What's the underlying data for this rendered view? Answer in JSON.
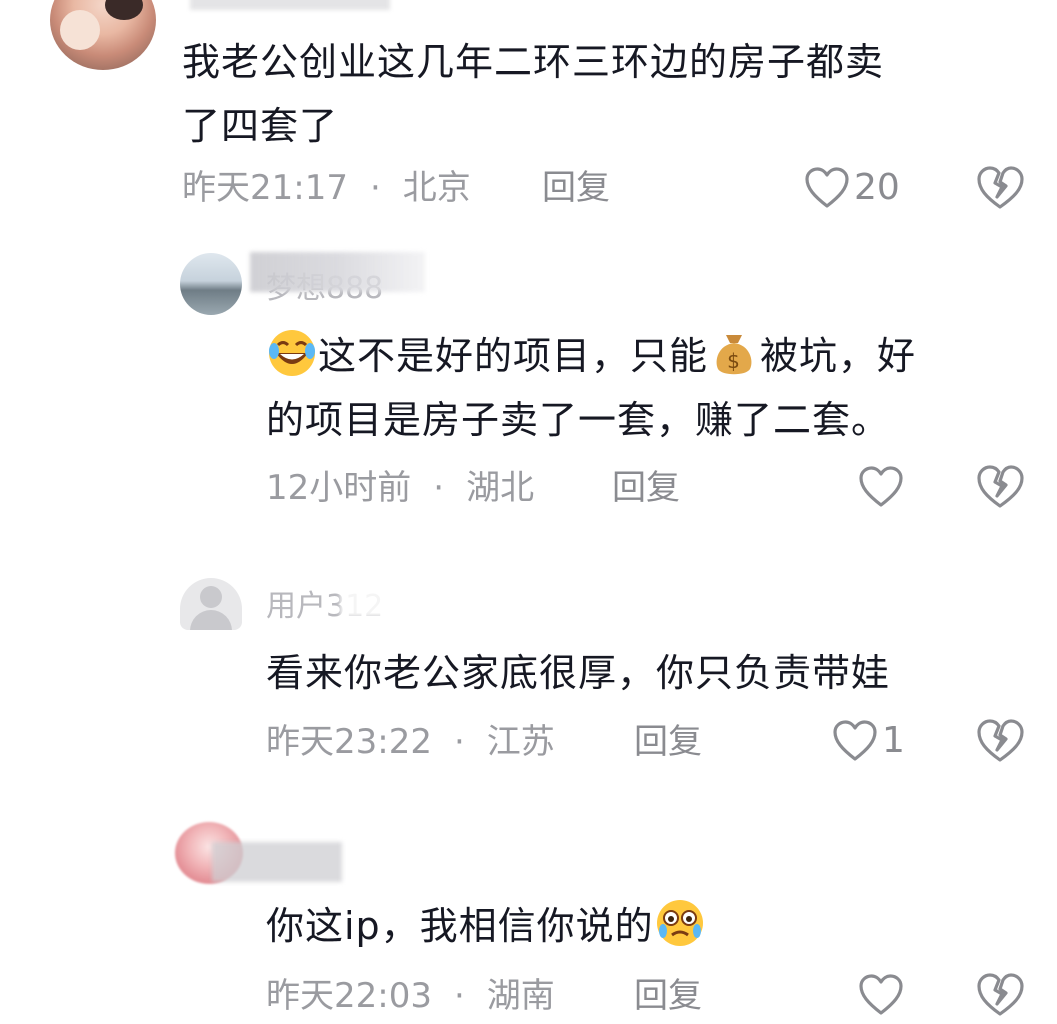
{
  "comments": [
    {
      "username": "",
      "text_line1": "我老公创业这几年二环三环边的房子都卖",
      "text_line2": "了四套了",
      "time": "昨天21:17",
      "location": "北京",
      "reply_label": "回复",
      "likes": "20"
    },
    {
      "username": "梦想888",
      "text_line1": "这不是好的项目，只能",
      "text_line1b": "被坑，好",
      "text_line2": "的项目是房子卖了一套，赚了二套。",
      "time": "12小时前",
      "location": "湖北",
      "reply_label": "回复",
      "likes": ""
    },
    {
      "username": "用户312",
      "text_line1": "看来你老公家底很厚，你只负责带娃",
      "time": "昨天23:22",
      "location": "江苏",
      "reply_label": "回复",
      "likes": "1"
    },
    {
      "username": "",
      "text_line1": "你这ip，我相信你说的",
      "time": "昨天22:03",
      "location": "湖南",
      "reply_label": "回复",
      "likes": ""
    }
  ],
  "icons": {
    "like": "heart-outline-icon",
    "dislike": "broken-heart-icon",
    "emoji_laugh": "rolling-laughing-emoji",
    "emoji_money": "money-bag-emoji",
    "emoji_cry": "teary-emoji"
  },
  "colors": {
    "text": "#161823",
    "meta": "#9a9ba0",
    "icon": "#8a8b90"
  }
}
